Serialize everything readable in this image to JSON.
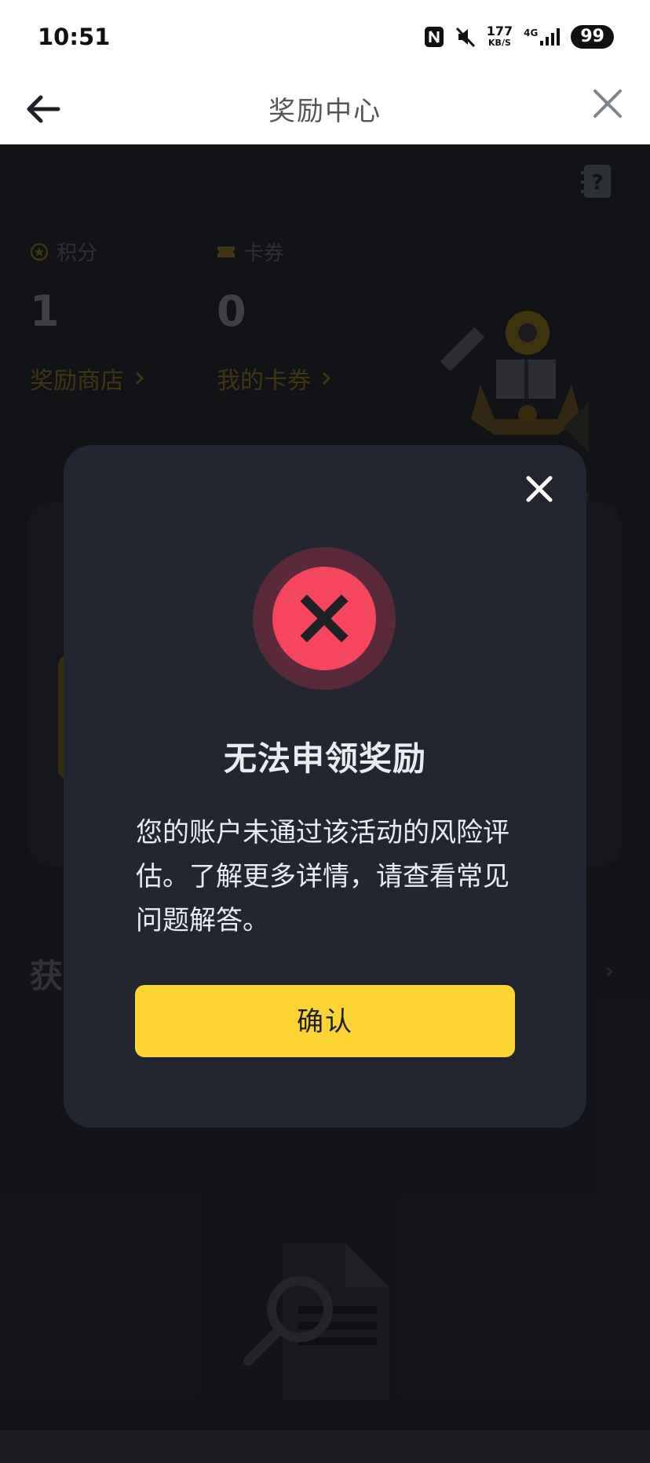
{
  "status_bar": {
    "time": "10:51",
    "network_speed": "177",
    "network_speed_unit": "KB/S",
    "network_type": "4G",
    "battery": "99"
  },
  "nav": {
    "title": "奖励中心"
  },
  "background": {
    "points": {
      "label": "积分",
      "value": "1",
      "link": "奖励商店"
    },
    "coupons": {
      "label": "卡券",
      "value": "0",
      "link": "我的卡券"
    },
    "section_title": "获"
  },
  "dialog": {
    "title": "无法申领奖励",
    "message": "您的账户未通过该活动的风险评估。了解更多详情，请查看常见问题解答。",
    "confirm_label": "确认"
  },
  "colors": {
    "accent_yellow": "#fcd535",
    "error_red": "#f6465d",
    "dialog_bg": "#232630",
    "page_bg": "#181a20"
  }
}
